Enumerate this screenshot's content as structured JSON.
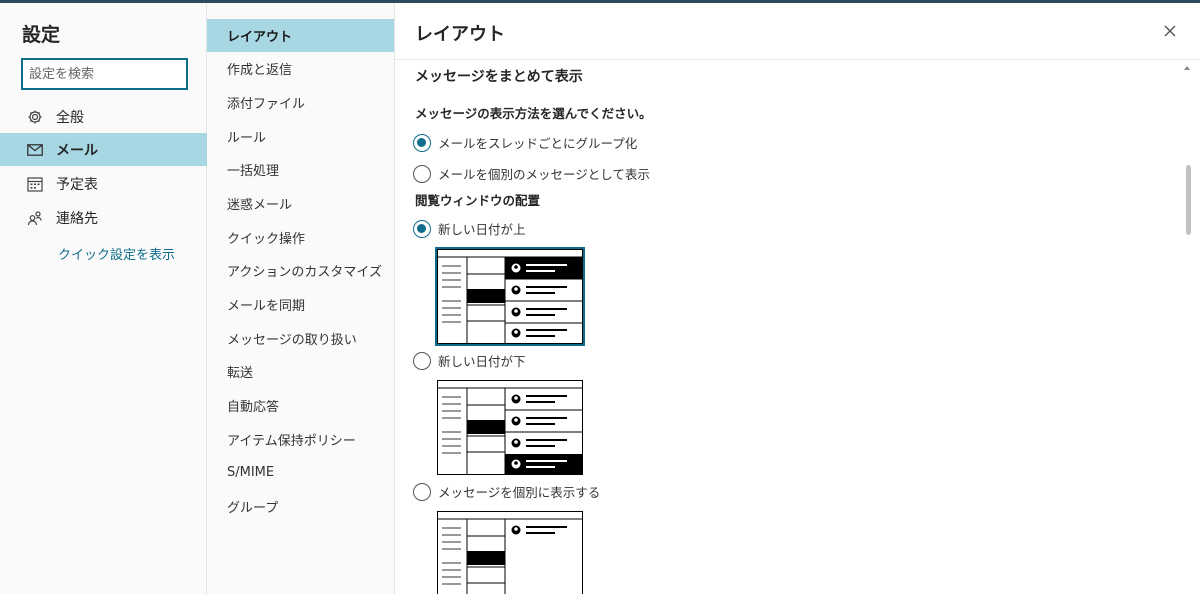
{
  "settings": {
    "title": "設定",
    "search_placeholder": "設定を検索",
    "categories": [
      {
        "label": "全般",
        "icon": "gear-icon"
      },
      {
        "label": "メール",
        "icon": "mail-icon"
      },
      {
        "label": "予定表",
        "icon": "calendar-icon"
      },
      {
        "label": "連絡先",
        "icon": "people-icon"
      }
    ],
    "quick_settings": "クイック設定を表示"
  },
  "mail_menu": {
    "items": [
      "レイアウト",
      "作成と返信",
      "添付ファイル",
      "ルール",
      "一括処理",
      "迷惑メール",
      "クイック操作",
      "アクションのカスタマイズ",
      "メールを同期",
      "メッセージの取り扱い",
      "転送",
      "自動応答",
      "アイテム保持ポリシー",
      "S/MIME",
      "グループ"
    ],
    "active": "レイアウト"
  },
  "pane": {
    "title": "レイアウト",
    "section_title": "メッセージをまとめて表示",
    "question": "メッセージの表示方法を選んでください。",
    "options": [
      {
        "label": "メールをスレッドごとにグループ化",
        "checked": true
      },
      {
        "label": "メールを個別のメッセージとして表示",
        "checked": false
      }
    ],
    "reading_pane_title": "閲覧ウィンドウの配置",
    "reading_options": [
      {
        "label": "新しい日付が上",
        "checked": true
      },
      {
        "label": "新しい日付が下",
        "checked": false
      },
      {
        "label": "メッセージを個別に表示する",
        "checked": false
      }
    ]
  },
  "colors": {
    "accent": "#0f6c8b",
    "selected_bg": "#a7d7e3",
    "link": "#0f6c8b"
  }
}
